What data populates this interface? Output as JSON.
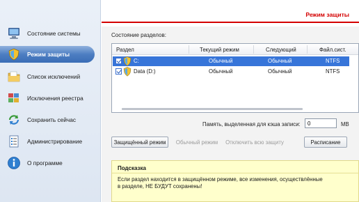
{
  "sidebar": {
    "items": [
      {
        "label": "Состояние системы",
        "icon": "computer-icon",
        "active": false
      },
      {
        "label": "Режим защиты",
        "icon": "shield-icon",
        "active": true
      },
      {
        "label": "Список исключений",
        "icon": "folder-icon",
        "active": false
      },
      {
        "label": "Исключения реестра",
        "icon": "registry-icon",
        "active": false
      },
      {
        "label": "Сохранить сейчас",
        "icon": "save-arrows-icon",
        "active": false
      },
      {
        "label": "Администрирование",
        "icon": "admin-list-icon",
        "active": false
      },
      {
        "label": "О программе",
        "icon": "info-icon",
        "active": false
      }
    ]
  },
  "header": {
    "title": "Режим защиты",
    "accent_color": "#d40000"
  },
  "partitions": {
    "section_label": "Состояние разделов:",
    "columns": [
      "Раздел",
      "Текущий режим",
      "Следующий",
      "Файл.сист."
    ],
    "rows": [
      {
        "name": "C:",
        "current": "Обычный",
        "next": "Обычный",
        "fs": "NTFS",
        "checked": true,
        "selected": true
      },
      {
        "name": "Data (D:)",
        "current": "Обычный",
        "next": "Обычный",
        "fs": "NTFS",
        "checked": true,
        "selected": false
      }
    ]
  },
  "cache": {
    "label": "Память, выделенная для кэша записи:",
    "value": "0",
    "unit": "MB"
  },
  "buttons": {
    "protected": "Защищённый режим",
    "normal": "Обычный режим",
    "disable": "Отключить всю защиту",
    "schedule": "Расписание"
  },
  "hint": {
    "title": "Подсказка",
    "body": "Если раздел находится в защищённом режиме, все изменения, осуществлённые в разделе, НЕ БУДУТ сохранены!"
  },
  "colors": {
    "selection": "#3775d9",
    "hint_bg": "#ffffcc",
    "sidebar_active": "#4d7ec2"
  }
}
